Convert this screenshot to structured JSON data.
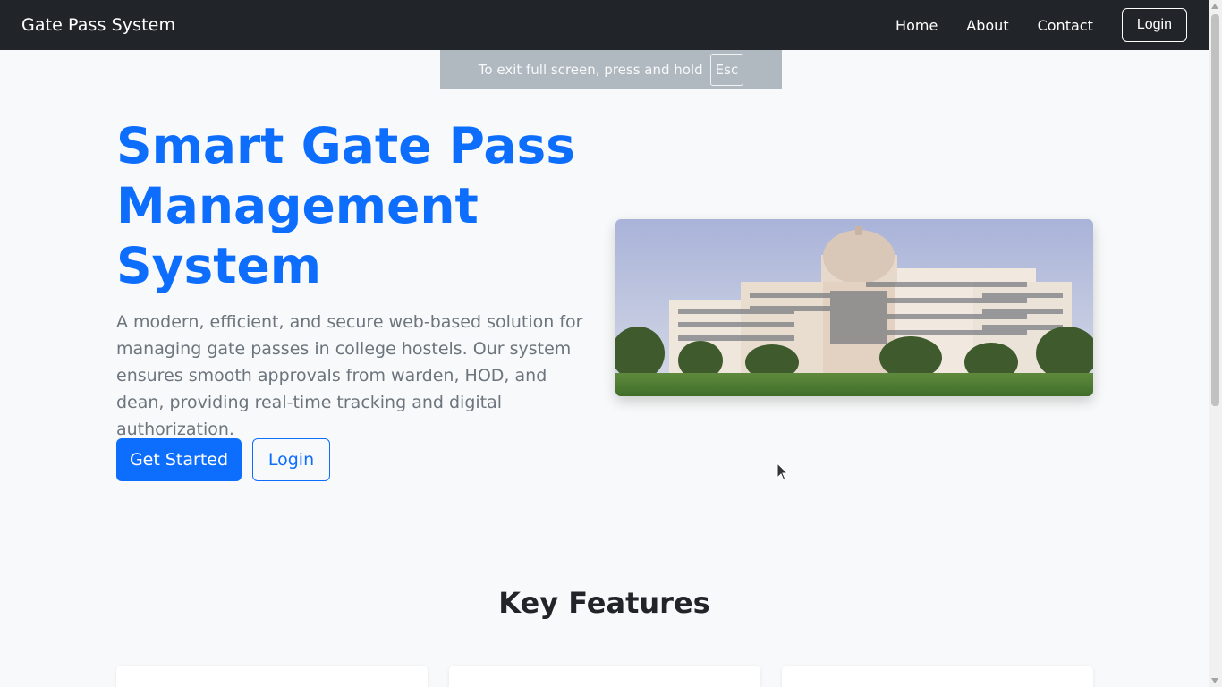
{
  "navbar": {
    "brand": "Gate Pass System",
    "links": [
      "Home",
      "About",
      "Contact"
    ],
    "login_label": "Login"
  },
  "fullscreen_notice": {
    "text": "To exit full screen, press and hold",
    "key": "Esc"
  },
  "hero": {
    "title": "Smart Gate Pass Management System",
    "description": "A modern, efficient, and secure web-based solution for managing gate passes in college hostels. Our system ensures smooth approvals from warden, HOD, and dean, providing real-time tracking and digital authorization.",
    "primary_button": "Get Started",
    "secondary_button": "Login",
    "image_icon": "college-building-photo"
  },
  "features": {
    "title": "Key Features"
  },
  "colors": {
    "primary": "#0d6efd",
    "navbar": "#212529",
    "background": "#f8f9fa",
    "muted_text": "#6c757d"
  }
}
